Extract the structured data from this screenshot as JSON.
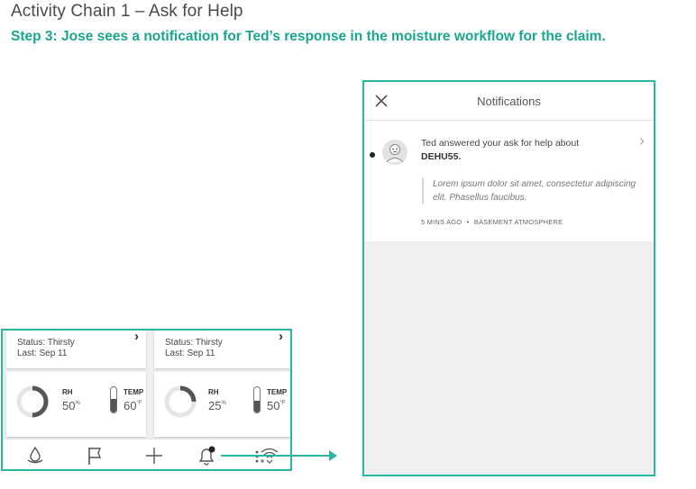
{
  "header": {
    "title": "Activity Chain 1 – Ask for Help",
    "subtitle": "Step 3: Jose sees a notification for Ted’s response in the moisture workflow for the claim."
  },
  "left_panel": {
    "cards": [
      {
        "status": "Status: Thirsty",
        "last": "Last: Sep 11",
        "rh_label": "RH",
        "rh_value": "50",
        "rh_unit": "%",
        "rh_fraction": 0.5,
        "temp_label": "TEMP",
        "temp_value": "60",
        "temp_unit": "°F",
        "temp_fill": 0.55
      },
      {
        "status": "Status: Thirsty",
        "last": "Last: Sep 11",
        "rh_label": "RH",
        "rh_value": "25",
        "rh_unit": "%",
        "rh_fraction": 0.25,
        "temp_label": "TEMP",
        "temp_value": "50",
        "temp_unit": "°F",
        "temp_fill": 0.45
      }
    ],
    "chevron": "›",
    "nav": [
      "water-drop-icon",
      "flag-icon",
      "plus-icon",
      "bell-icon",
      "sensor-wifi-icon"
    ]
  },
  "notifications": {
    "title": "Notifications",
    "item": {
      "text": "Ted answered your ask for help about",
      "subject": "DEHU55.",
      "quote": "Lorem ipsum dolor sit amet, consectetur adipiscing elit. Phasellus faucibus.",
      "time": "5 MINS AGO",
      "separator": "•",
      "location": "BASEMENT ATMOSPHERE",
      "chevron": "›"
    }
  },
  "colors": {
    "accent": "#2bb5a3",
    "subtitle": "#1aa58e"
  }
}
